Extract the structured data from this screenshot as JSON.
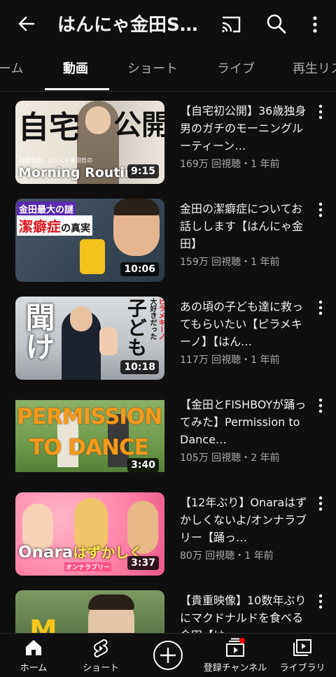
{
  "header": {
    "title": "はんにゃ金田SH…",
    "icons": [
      "back-arrow-icon",
      "cast-icon",
      "search-icon",
      "more-vert-icon"
    ]
  },
  "tabs": [
    {
      "label": "ーム"
    },
    {
      "label": "動画",
      "active": true
    },
    {
      "label": "ショート"
    },
    {
      "label": "ライブ"
    },
    {
      "label": "再生リス"
    }
  ],
  "videos": [
    {
      "title": "【自宅初公開】36歳独身男のガチのモーニングルーティーン…",
      "meta": "169万 回視聴・1 年前",
      "duration": "9:15",
      "thumb_text_top": "自宅",
      "thumb_text_top2": "公開",
      "thumb_text_bottom": "Morning Routine",
      "thumb_caption": "36歳独身、はんにゃ金田哲の",
      "thumb_bg": "#e8e2d8"
    },
    {
      "title": "金田の潔癖症についてお話しします【はんにゃ金田】",
      "meta": "159万 回視聴・1 年前",
      "duration": "10:06",
      "thumb_text_top": "金田最大の謎",
      "thumb_text_mid": "潔癖症",
      "thumb_text_mid2": "の真実",
      "thumb_bg": "#3b4a5a"
    },
    {
      "title": "あの頃の子ども達に救ってもらいたい【ピラメキーノ】【はん…",
      "meta": "117万 回視聴・1 年前",
      "duration": "10:18",
      "thumb_text_left": "聞け",
      "thumb_text_right": "子ども",
      "thumb_text_right2": "大好きだった",
      "thumb_text_right3": "ピラメキーノ",
      "thumb_bg": "#cfd4d8"
    },
    {
      "title": "【金田とFISHBOYが踊ってみた】Permission to Dance…",
      "meta": "105万 回視聴・2 年前",
      "duration": "3:40",
      "thumb_text_top": "PERMISSION",
      "thumb_text_bottom": "TO DANCE",
      "thumb_bg": "#6f9a4a"
    },
    {
      "title": "【12年ぶり】Onaraはずかしくないよ/オンナラブリー【踊っ…",
      "meta": "80万 回視聴・1 年前",
      "duration": "3:37",
      "thumb_text_main": "Onara",
      "thumb_text_main2": "はずかしく",
      "thumb_caption": "オンナラブリー",
      "thumb_bg": "#ff8fb0"
    },
    {
      "title": "【貴重映像】10数年ぶりにマクドナルドを食べる金田【は…",
      "meta": "",
      "duration": "",
      "thumb_bg": "#5d7a4a"
    }
  ],
  "bottom_nav": [
    {
      "label": "ホーム",
      "icon": "home-icon"
    },
    {
      "label": "ショート",
      "icon": "shorts-icon"
    },
    {
      "label": "",
      "icon": "create-plus-icon"
    },
    {
      "label": "登録チャンネル",
      "icon": "subscriptions-icon",
      "badge": true
    },
    {
      "label": "ライブラリ",
      "icon": "library-icon"
    }
  ],
  "colors": {
    "background": "#0f0f0f",
    "text": "#f1f1f1",
    "meta": "#aaaaaa",
    "badge": "#ff0000"
  }
}
